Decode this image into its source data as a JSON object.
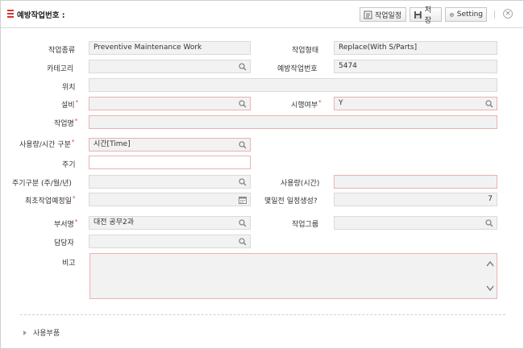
{
  "window": {
    "title": "예방작업번호 :"
  },
  "toolbar": {
    "schedule_label": "작업일정",
    "save_label": "저장",
    "setting_label": "Setting"
  },
  "labels": {
    "work_type": "작업종류",
    "work_form": "작업형태",
    "category": "카테고리",
    "pm_no": "예방작업번호",
    "location": "위치",
    "equipment": "설비",
    "is_applied": "시행여부",
    "work_name": "작업명",
    "usage_time_div": "사용량/시간 구분",
    "cycle": "주기",
    "cycle_div": "주기구분 (주/월/년)",
    "usage_time": "사용량(시간)",
    "first_date": "최초작업예정일",
    "days_before": "몇일전 일정생성?",
    "dept": "부서명",
    "work_group": "작업그룹",
    "manager": "담당자",
    "remarks": "비고",
    "parts_section": "사용부품"
  },
  "values": {
    "work_type": "Preventive Maintenance Work",
    "work_form": "Replace(With S/Parts]",
    "category": "",
    "pm_no": "5474",
    "location": "",
    "equipment": "",
    "is_applied": "Y",
    "work_name": "",
    "usage_time_div": "시간[Time]",
    "cycle": "",
    "cycle_div": "",
    "usage_time": "",
    "first_date": "",
    "days_before": "7",
    "dept": "대전 공무2과",
    "work_group": "",
    "manager": "",
    "remarks": ""
  },
  "required_mark": "*",
  "colors": {
    "accent": "#d9342b",
    "field_bg": "#f2f2f2",
    "required_border": "#eab2b2"
  }
}
